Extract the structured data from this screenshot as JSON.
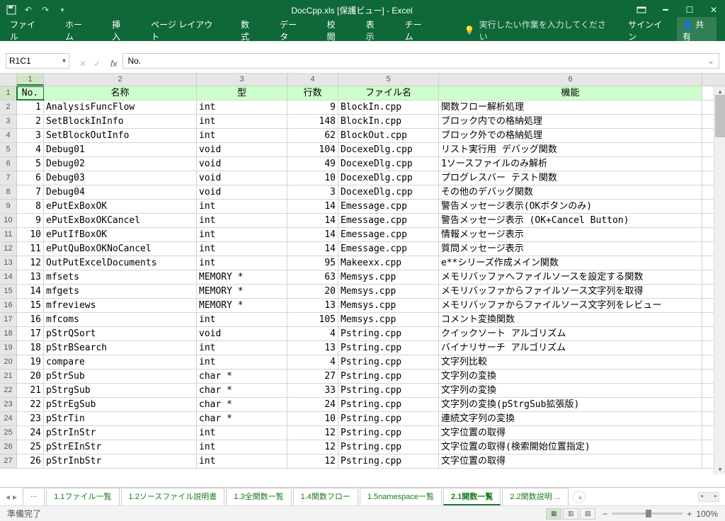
{
  "title": "DocCpp.xls [保護ビュー] - Excel",
  "ribbon": {
    "tabs": [
      "ファイル",
      "ホーム",
      "挿入",
      "ページ レイアウト",
      "数式",
      "データ",
      "校閲",
      "表示",
      "チーム"
    ],
    "tellme": "実行したい作業を入力してください",
    "signin": "サインイン",
    "share": "共有"
  },
  "namebox": "R1C1",
  "formula": "No.",
  "colHeaders": [
    "1",
    "2",
    "3",
    "4",
    "5",
    "6"
  ],
  "tableHeaders": [
    "No.",
    "名称",
    "型",
    "行数",
    "ファイル名",
    "機能"
  ],
  "rows": [
    {
      "n": 1,
      "name": "AnalysisFuncFlow",
      "type": "int",
      "lines": 9,
      "file": "BlockIn.cpp",
      "desc": "関数フロー解析処理"
    },
    {
      "n": 2,
      "name": "SetBlockInInfo",
      "type": "int",
      "lines": 148,
      "file": "BlockIn.cpp",
      "desc": "ブロック内での格納処理"
    },
    {
      "n": 3,
      "name": "SetBlockOutInfo",
      "type": "int",
      "lines": 62,
      "file": "BlockOut.cpp",
      "desc": "ブロック外での格納処理"
    },
    {
      "n": 4,
      "name": "Debug01",
      "type": "void",
      "lines": 104,
      "file": "DocexeDlg.cpp",
      "desc": "リスト実行用 デバッグ関数"
    },
    {
      "n": 5,
      "name": "Debug02",
      "type": "void",
      "lines": 49,
      "file": "DocexeDlg.cpp",
      "desc": "1ソースファイルのみ解析"
    },
    {
      "n": 6,
      "name": "Debug03",
      "type": "void",
      "lines": 10,
      "file": "DocexeDlg.cpp",
      "desc": "プログレスバー テスト関数"
    },
    {
      "n": 7,
      "name": "Debug04",
      "type": "void",
      "lines": 3,
      "file": "DocexeDlg.cpp",
      "desc": "その他のデバッグ関数"
    },
    {
      "n": 8,
      "name": "ePutExBoxOK",
      "type": "int",
      "lines": 14,
      "file": "Emessage.cpp",
      "desc": "警告メッセージ表示(OKボタンのみ)"
    },
    {
      "n": 9,
      "name": "ePutExBoxOKCancel",
      "type": "int",
      "lines": 14,
      "file": "Emessage.cpp",
      "desc": "警告メッセージ表示 (OK+Cancel Button)"
    },
    {
      "n": 10,
      "name": "ePutIfBoxOK",
      "type": "int",
      "lines": 14,
      "file": "Emessage.cpp",
      "desc": "情報メッセージ表示"
    },
    {
      "n": 11,
      "name": "ePutQuBoxOKNoCancel",
      "type": "int",
      "lines": 14,
      "file": "Emessage.cpp",
      "desc": "質問メッセージ表示"
    },
    {
      "n": 12,
      "name": "OutPutExcelDocuments",
      "type": "int",
      "lines": 95,
      "file": "Makeexx.cpp",
      "desc": "e**シリーズ作成メイン関数"
    },
    {
      "n": 13,
      "name": "mfsets",
      "type": "MEMORY *",
      "lines": 63,
      "file": "Memsys.cpp",
      "desc": "メモリバッファへファイルソースを設定する関数"
    },
    {
      "n": 14,
      "name": "mfgets",
      "type": "MEMORY *",
      "lines": 20,
      "file": "Memsys.cpp",
      "desc": "メモリバッファからファイルソース文字列を取得"
    },
    {
      "n": 15,
      "name": "mfreviews",
      "type": "MEMORY *",
      "lines": 13,
      "file": "Memsys.cpp",
      "desc": "メモリバッファからファイルソース文字列をレビュー"
    },
    {
      "n": 16,
      "name": "mfcoms",
      "type": "int",
      "lines": 105,
      "file": "Memsys.cpp",
      "desc": "コメント変換関数"
    },
    {
      "n": 17,
      "name": "pStrQSort",
      "type": "void",
      "lines": 4,
      "file": "Pstring.cpp",
      "desc": "クイックソート アルゴリズム"
    },
    {
      "n": 18,
      "name": "pStrBSearch",
      "type": "int",
      "lines": 13,
      "file": "Pstring.cpp",
      "desc": "バイナリサーチ アルゴリズム"
    },
    {
      "n": 19,
      "name": "compare",
      "type": "int",
      "lines": 4,
      "file": "Pstring.cpp",
      "desc": "文字列比較"
    },
    {
      "n": 20,
      "name": "pStrSub",
      "type": "char *",
      "lines": 27,
      "file": "Pstring.cpp",
      "desc": "文字列の変換"
    },
    {
      "n": 21,
      "name": "pStrgSub",
      "type": "char *",
      "lines": 33,
      "file": "Pstring.cpp",
      "desc": "文字列の変換"
    },
    {
      "n": 22,
      "name": "pStrEgSub",
      "type": "char *",
      "lines": 24,
      "file": "Pstring.cpp",
      "desc": "文字列の変換(pStrgSub拡張版)"
    },
    {
      "n": 23,
      "name": "pStrTin",
      "type": "char *",
      "lines": 10,
      "file": "Pstring.cpp",
      "desc": "連続文字列の変換"
    },
    {
      "n": 24,
      "name": "pStrInStr",
      "type": "int",
      "lines": 12,
      "file": "Pstring.cpp",
      "desc": "文字位置の取得"
    },
    {
      "n": 25,
      "name": "pStrEInStr",
      "type": "int",
      "lines": 12,
      "file": "Pstring.cpp",
      "desc": "文字位置の取得(検索開始位置指定)"
    },
    {
      "n": 26,
      "name": "pStrInbStr",
      "type": "int",
      "lines": 12,
      "file": "Pstring.cpp",
      "desc": "文字位置の取得"
    }
  ],
  "sheets": [
    "...",
    "1.1ファイル一覧",
    "1.2ソースファイル説明書",
    "1.3全関数一覧",
    "1.4関数フロー",
    "1.5namespace一覧",
    "2.1関数一覧",
    "2.2関数説明 ..."
  ],
  "activeSheet": 6,
  "status": "準備完了",
  "zoom": "100%"
}
